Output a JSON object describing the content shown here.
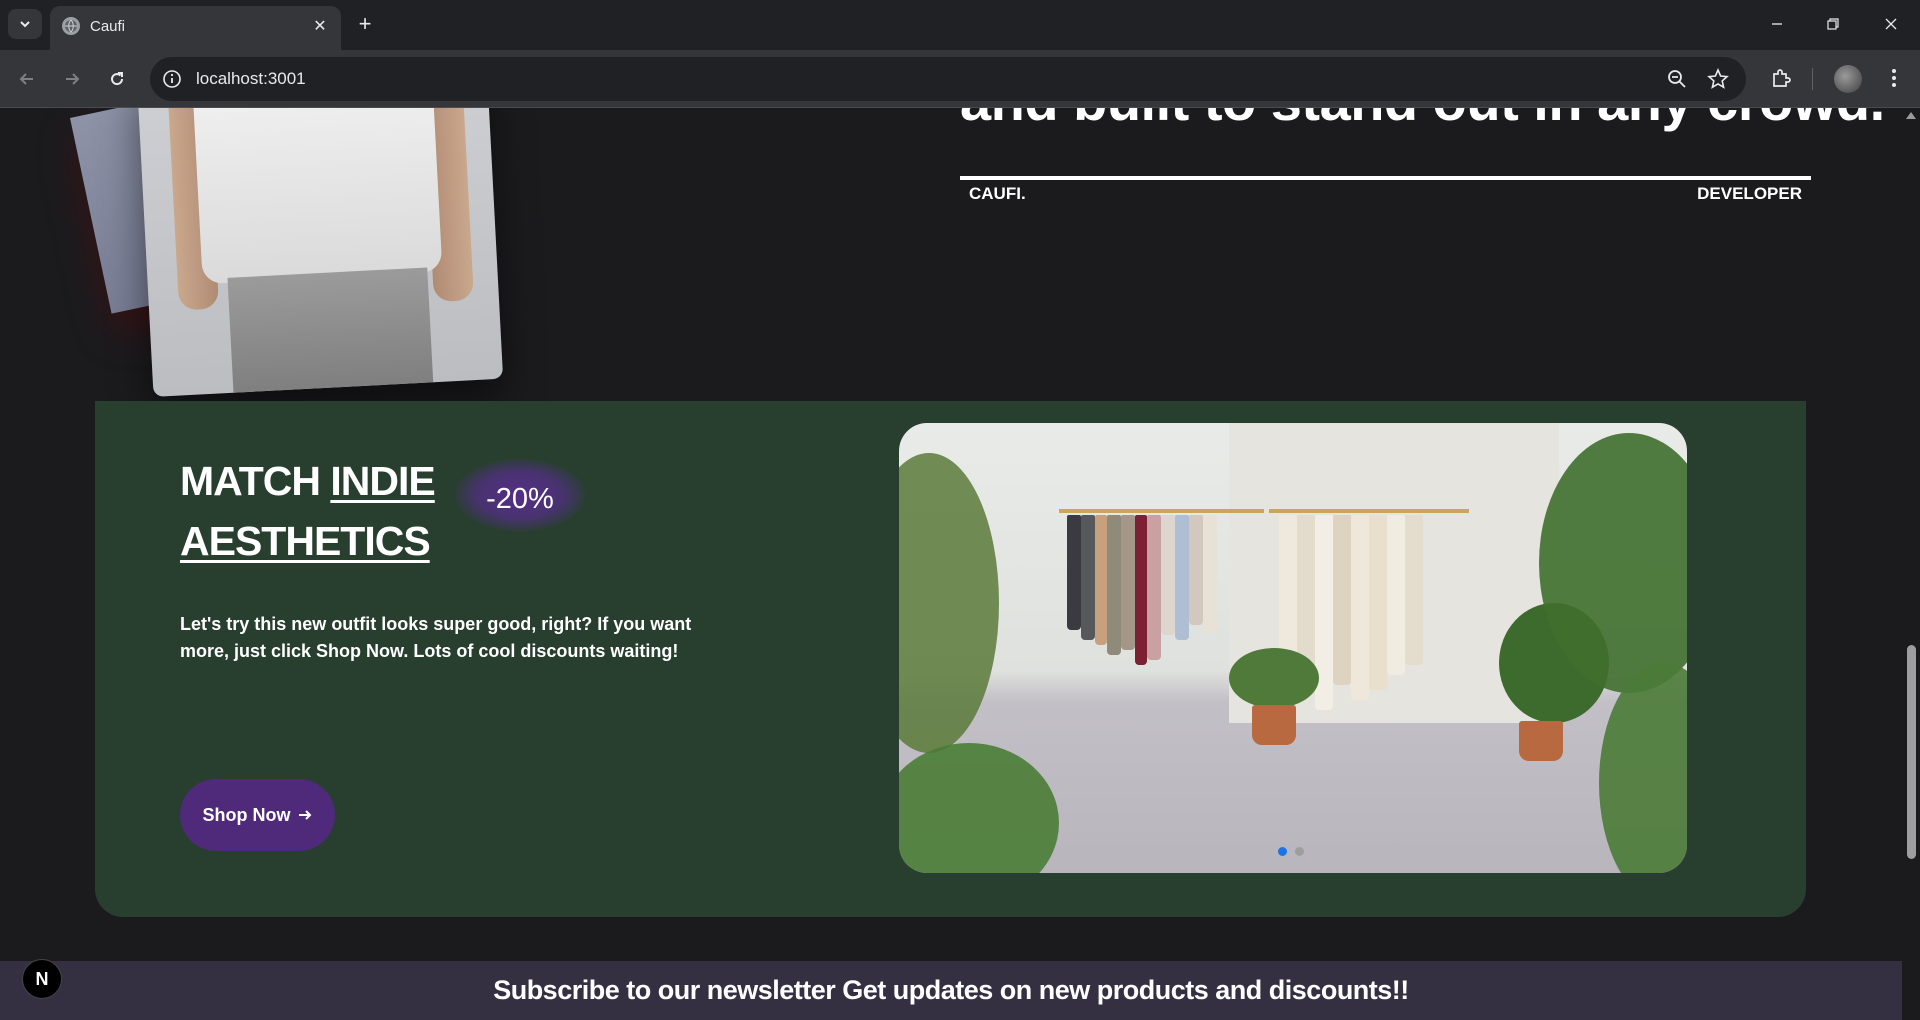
{
  "browser": {
    "tab_title": "Caufi",
    "url": "localhost:3001"
  },
  "hero": {
    "partial_heading": "and built to stand out in any crowd.",
    "left_label": "CAUFI.",
    "right_label": "DEVELOPER"
  },
  "promo": {
    "title_word1": "MATCH",
    "title_word2": "INDIE",
    "title_word3": "AESTHETICS",
    "discount": "-20%",
    "description": "Let's try this new outfit looks super good, right? If you want more, just click Shop Now. Lots of cool discounts waiting!",
    "shop_button": "Shop Now",
    "carousel": {
      "slide_count": 2,
      "active_index": 0
    }
  },
  "newsletter": {
    "text": "Subscribe to our newsletter Get updates on new products and discounts!!"
  },
  "dev_badge": "N",
  "colors": {
    "page_bg": "#1b1b1e",
    "promo_bg": "#283f30",
    "accent_purple": "#4f2a7a",
    "newsletter_bg": "#343041",
    "dot_active": "#1a73e8",
    "dot_inactive": "#9e9e9e"
  },
  "icons": [
    "tab-search-icon",
    "globe-icon",
    "close-icon",
    "plus-icon",
    "minimize-icon",
    "restore-icon",
    "back-icon",
    "forward-icon",
    "reload-icon",
    "info-icon",
    "zoom-out-icon",
    "star-icon",
    "extensions-icon",
    "menu-icon",
    "arrow-right-icon"
  ]
}
